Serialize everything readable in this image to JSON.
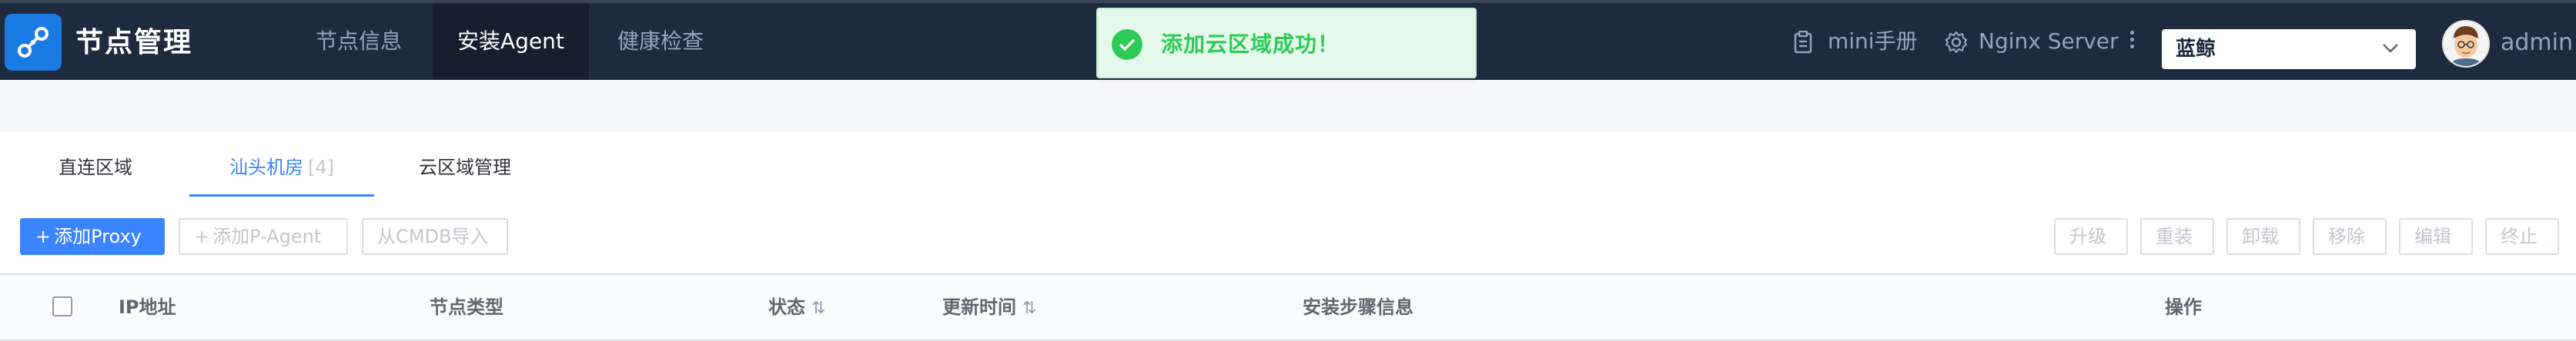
{
  "header": {
    "title": "节点管理",
    "nav": [
      "节点信息",
      "安装Agent",
      "健康检查"
    ],
    "active_nav": "安装Agent",
    "manual_label": "mini手册",
    "server_label": "Nginx Server",
    "business_value": "蓝鲸",
    "user_name": "admin"
  },
  "toast": {
    "message": "添加云区域成功！"
  },
  "tabs": {
    "items": [
      {
        "label": "直连区域",
        "count": ""
      },
      {
        "label": "汕头机房",
        "count": "[4]"
      },
      {
        "label": "云区域管理",
        "count": ""
      }
    ],
    "active": "汕头机房"
  },
  "toolbar": {
    "add_proxy": "添加Proxy",
    "add_pagent": "添加P-Agent",
    "cmdb_import": "从CMDB导入",
    "upgrade": "升级",
    "reinstall": "重装",
    "uninstall": "卸载",
    "remove": "移除",
    "edit": "编辑",
    "terminate": "终止"
  },
  "table": {
    "columns": [
      "IP地址",
      "节点类型",
      "状态",
      "更新时间",
      "安装步骤信息",
      "操作"
    ],
    "sortable": [
      "状态",
      "更新时间"
    ]
  },
  "colors": {
    "nav_bg": "#1e2b3f",
    "accent": "#3a84ff",
    "success": "#2dcb56"
  }
}
